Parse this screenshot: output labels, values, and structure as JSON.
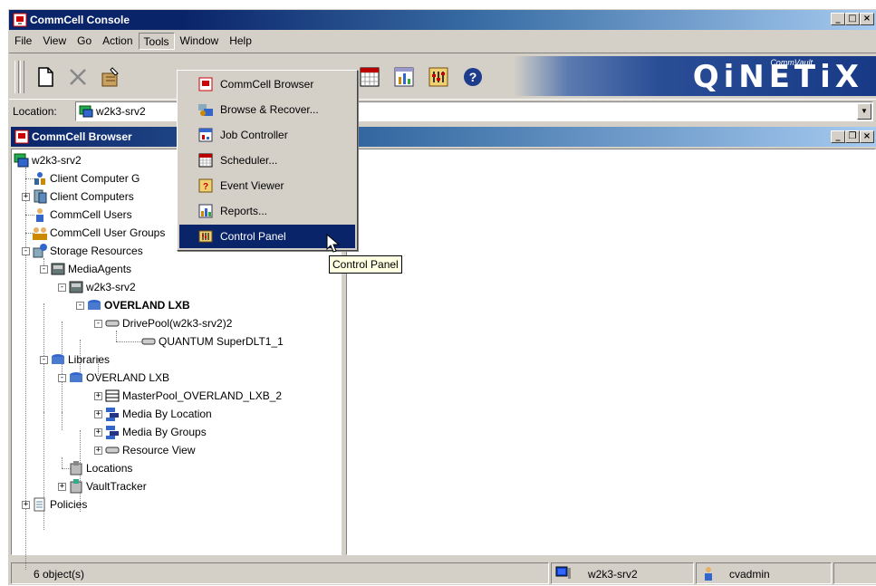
{
  "app": {
    "title": "CommCell Console"
  },
  "menu": [
    "File",
    "View",
    "Go",
    "Action",
    "Tools",
    "Window",
    "Help"
  ],
  "tools_menu": [
    {
      "label": "CommCell Browser",
      "icon": "commcell-browser-icon"
    },
    {
      "label": "Browse & Recover...",
      "icon": "browse-recover-icon"
    },
    {
      "label": "Job Controller",
      "icon": "job-controller-icon"
    },
    {
      "label": "Scheduler...",
      "icon": "scheduler-icon"
    },
    {
      "label": "Event Viewer",
      "icon": "event-viewer-icon"
    },
    {
      "label": "Reports...",
      "icon": "reports-icon"
    },
    {
      "label": "Control Panel",
      "icon": "control-panel-icon",
      "highlighted": true
    }
  ],
  "tooltip": "Control Panel",
  "logo": {
    "text": "QiNETiX",
    "small": "CommVault"
  },
  "location": {
    "label": "Location:",
    "value": "w2k3-srv2"
  },
  "browser": {
    "title": "CommCell Browser"
  },
  "tree": [
    {
      "label": "w2k3-srv2",
      "icon": "commcell-icon"
    },
    {
      "label": "Client Computer G",
      "icon": "client-group-icon"
    },
    {
      "label": "Client Computers",
      "icon": "client-computers-icon"
    },
    {
      "label": "CommCell Users",
      "icon": "user-icon"
    },
    {
      "label": "CommCell User Groups",
      "icon": "user-groups-icon"
    },
    {
      "label": "Storage Resources",
      "icon": "storage-icon"
    },
    {
      "label": "MediaAgents",
      "icon": "media-agents-icon"
    },
    {
      "label": "w2k3-srv2",
      "icon": "media-agent-icon"
    },
    {
      "label": "OVERLAND LXB",
      "icon": "library-icon",
      "bold": true
    },
    {
      "label": "DrivePool(w2k3-srv2)2",
      "icon": "drive-pool-icon"
    },
    {
      "label": "QUANTUM SuperDLT1_1",
      "icon": "drive-icon"
    },
    {
      "label": "Libraries",
      "icon": "libraries-icon"
    },
    {
      "label": "OVERLAND LXB",
      "icon": "library-icon"
    },
    {
      "label": "MasterPool_OVERLAND_LXB_2",
      "icon": "master-pool-icon"
    },
    {
      "label": "Media By Location",
      "icon": "media-location-icon"
    },
    {
      "label": "Media By Groups",
      "icon": "media-groups-icon"
    },
    {
      "label": "Resource View",
      "icon": "resource-view-icon"
    },
    {
      "label": "Locations",
      "icon": "locations-icon"
    },
    {
      "label": "VaultTracker",
      "icon": "vault-tracker-icon"
    },
    {
      "label": "Policies",
      "icon": "policies-icon"
    }
  ],
  "status": {
    "objects": "6 object(s)",
    "server": "w2k3-srv2",
    "user": "cvadmin"
  },
  "colors": {
    "title_active": "#0a246a",
    "face": "#d4d0c8"
  }
}
